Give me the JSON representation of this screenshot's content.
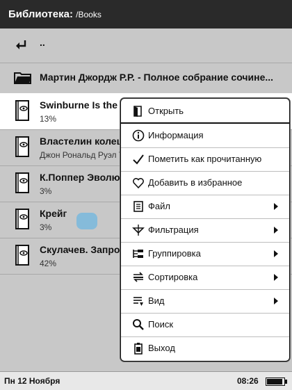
{
  "header": {
    "title": "Библиотека:",
    "path": "/Books"
  },
  "up_row": {
    "label": ".."
  },
  "folder_row": {
    "label": "Мартин Джордж Р.Р. - Полное собрание сочине..."
  },
  "books": [
    {
      "title": "Swinburne Is the",
      "subtitle": "13%"
    },
    {
      "title": "Властелин колец",
      "subtitle": "Джон Рональд Руэл Т"
    },
    {
      "title": "К.Поппер Эволю",
      "subtitle": "3%"
    },
    {
      "title": "Крейг",
      "subtitle": "3%"
    },
    {
      "title": "Скулачев. Запро",
      "subtitle": "42%"
    }
  ],
  "menu": {
    "items": [
      {
        "label": "Открыть",
        "icon": "open-book-icon",
        "submenu": false
      },
      {
        "label": "Информация",
        "icon": "info-icon",
        "submenu": false
      },
      {
        "label": "Пометить как прочитанную",
        "icon": "checkmark-icon",
        "submenu": false
      },
      {
        "label": "Добавить в избранное",
        "icon": "heart-icon",
        "submenu": false
      },
      {
        "label": "Файл",
        "icon": "file-icon",
        "submenu": true
      },
      {
        "label": "Фильтрация",
        "icon": "filter-icon",
        "submenu": true
      },
      {
        "label": "Группировка",
        "icon": "group-icon",
        "submenu": true
      },
      {
        "label": "Сортировка",
        "icon": "sort-icon",
        "submenu": true
      },
      {
        "label": "Вид",
        "icon": "view-icon",
        "submenu": true
      },
      {
        "label": "Поиск",
        "icon": "search-icon",
        "submenu": false
      },
      {
        "label": "Выход",
        "icon": "exit-icon",
        "submenu": false
      }
    ]
  },
  "status": {
    "date": "Пн 12 Ноября",
    "time": "08:26",
    "battery_level": 0.9
  },
  "colors": {
    "header_bg": "#2a2a2a",
    "list_bg": "#c8c8c8",
    "menu_bg": "#ffffff"
  }
}
